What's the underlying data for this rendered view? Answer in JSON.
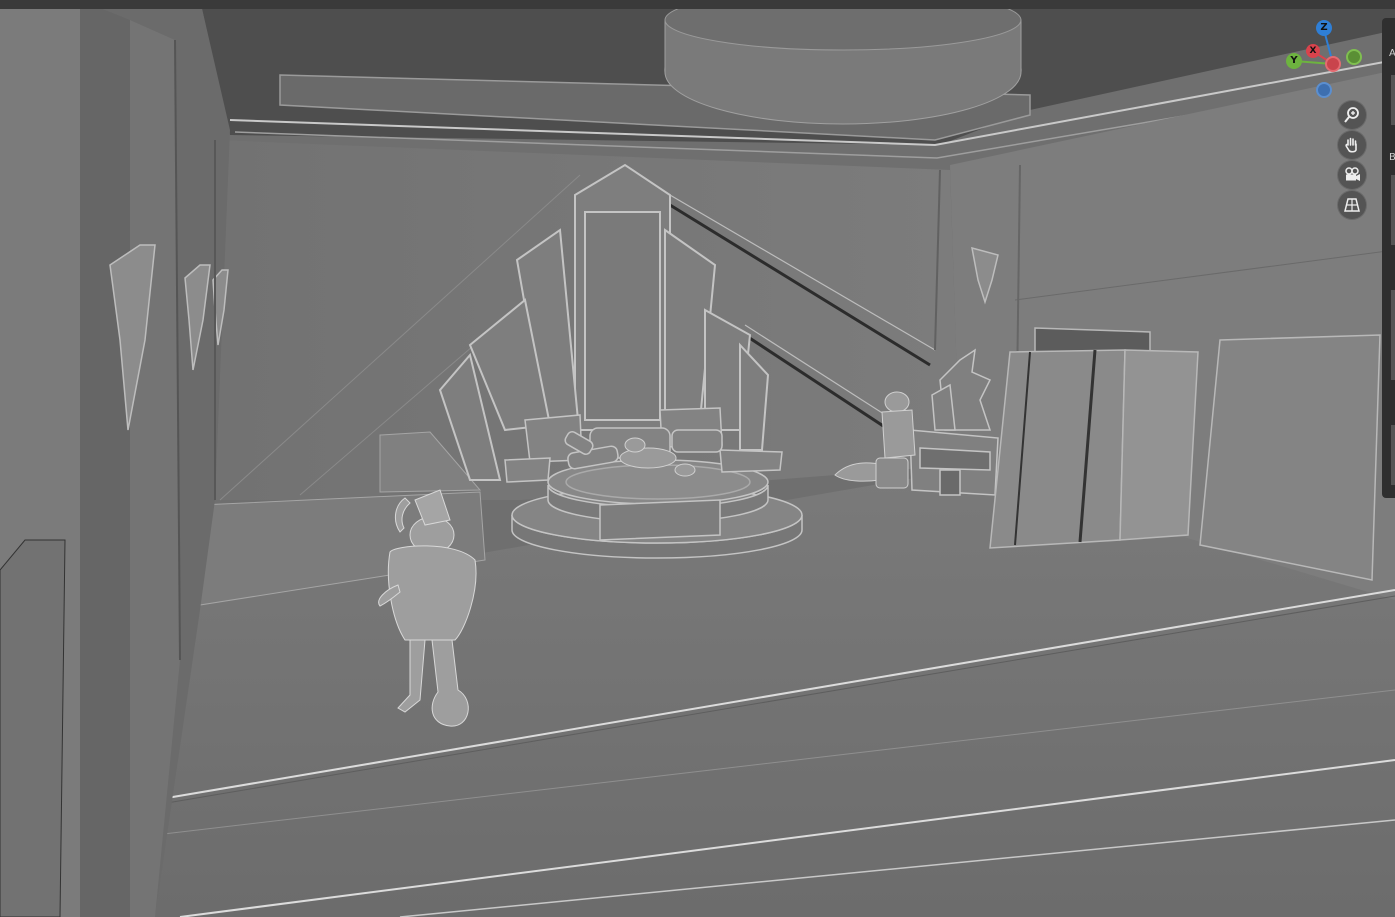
{
  "viewport": {
    "background": "#6f6f6f",
    "shading_mode": "solid"
  },
  "gizmo": {
    "axes": {
      "z": {
        "label": "Z",
        "color": "#2f7fd6"
      },
      "y": {
        "label": "Y",
        "color": "#6db33f"
      },
      "x": {
        "label": "X",
        "color": "#d9434c"
      },
      "neg_x_color": "#d9434c",
      "neg_y_color": "#6db33f",
      "neg_z_color": "#3d6fb0"
    }
  },
  "nav_buttons": [
    {
      "name": "zoom",
      "icon": "zoom-icon"
    },
    {
      "name": "pan",
      "icon": "hand-icon"
    },
    {
      "name": "camera",
      "icon": "camera-icon"
    },
    {
      "name": "perspective",
      "icon": "grid-perspective-icon"
    }
  ],
  "sidebar": {
    "tab_labels": [
      "A",
      "B"
    ]
  }
}
